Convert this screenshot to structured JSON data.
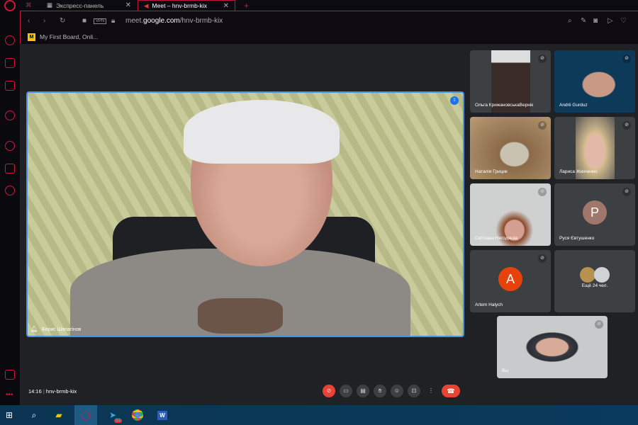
{
  "browser": {
    "tabs": [
      {
        "label": "Экспресс-панель",
        "active": false
      },
      {
        "label": "Meet – hnv-brmb-kix",
        "active": true
      }
    ],
    "new_tab": "+",
    "url_prefix": "meet.",
    "url_domain": "google.com",
    "url_path": "/hnv-brmb-kix",
    "vpn": "VPN",
    "bookmarks": [
      {
        "label": "My First Board, Onli...",
        "icon": "miro-icon"
      }
    ],
    "accent": "#d4153a"
  },
  "meet": {
    "main_speaker": "Борис Шапагінов",
    "participants": [
      {
        "name": "Ольга КрижановськаВернік",
        "muted": true
      },
      {
        "name": "Andrii Gurduz",
        "muted": true
      },
      {
        "name": "Наталія Грицик",
        "muted": true
      },
      {
        "name": "Лариса Жихченко",
        "muted": true
      },
      {
        "name": "Світлана Негодяєва",
        "muted": true
      },
      {
        "name": "Руся Євтушенко",
        "muted": true,
        "initial": "P",
        "avatar_color": "#a1766b"
      },
      {
        "name": "Artem Halych",
        "muted": true,
        "initial": "A",
        "avatar_color": "#e8420c"
      }
    ],
    "more_label": "Ещё 24 чел.",
    "self_label": "Вы",
    "time": "14:16",
    "meeting_code": "hnv-brmb-kix"
  },
  "taskbar": {
    "telegram_badge": "51"
  }
}
